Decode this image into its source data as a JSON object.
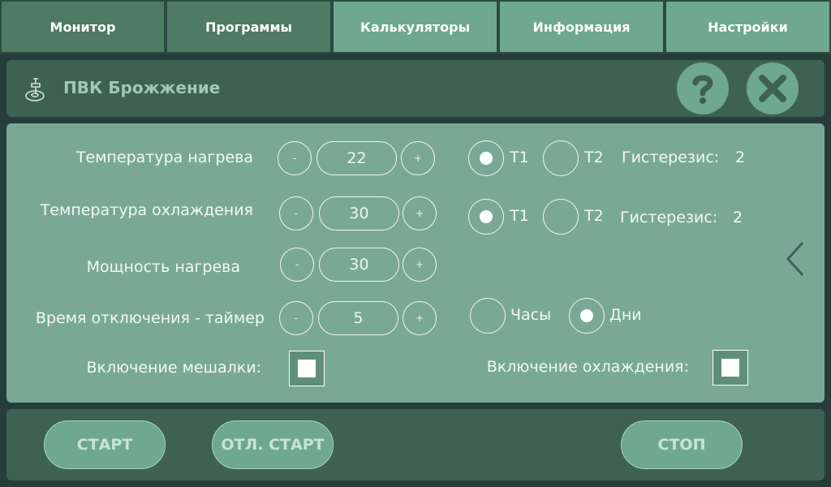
{
  "tabs": [
    {
      "label": "Монитор"
    },
    {
      "label": "Программы"
    },
    {
      "label": "Калькуляторы"
    },
    {
      "label": "Информация"
    },
    {
      "label": "Настройки"
    }
  ],
  "header": {
    "title": "ПВК Брожжение",
    "help_icon": "help-icon",
    "close_icon": "close-icon"
  },
  "settings": {
    "heat_temp": {
      "label": "Температура нагрева",
      "minus": "-",
      "value": "22",
      "plus": "+"
    },
    "cool_temp": {
      "label": "Температура охлаждения",
      "minus": "-",
      "value": "30",
      "plus": "+"
    },
    "heat_power": {
      "label": "Мощность нагрева",
      "minus": "-",
      "value": "30",
      "plus": "+"
    },
    "timer": {
      "label": "Время отключения - таймер",
      "minus": "-",
      "value": "5",
      "plus": "+"
    }
  },
  "heat_sensor": {
    "t1": "T1",
    "t2": "T2",
    "selected": "T1",
    "hysteresis_label": "Гистерезис:",
    "hysteresis_value": "2"
  },
  "cool_sensor": {
    "t1": "T1",
    "t2": "T2",
    "selected": "T1",
    "hysteresis_label": "Гистерезис:",
    "hysteresis_value": "2"
  },
  "timer_unit": {
    "hours": "Часы",
    "days": "Дни",
    "selected": "Дни"
  },
  "mixer": {
    "label": "Включение мешалки:",
    "checked": false
  },
  "cooling": {
    "label": "Включение охлаждения:",
    "checked": false
  },
  "actions": {
    "start": "СТАРТ",
    "delayed_start": "ОТЛ. СТАРТ",
    "stop": "СТОП"
  },
  "colors": {
    "tab_dark": "#4f7a64",
    "tab_light": "#6ea88e",
    "panel": "#79a996",
    "header": "#3f6153"
  }
}
